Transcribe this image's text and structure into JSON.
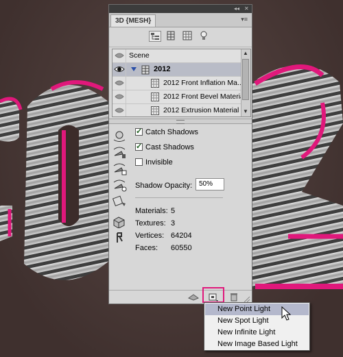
{
  "panel": {
    "tab_title": "3D {MESH}",
    "collapse_glyph": "◂◂",
    "close_glyph": "✕",
    "menu_glyph": "▾≡",
    "toolbar_icons": [
      "scene-filter-icon",
      "mesh-filter-icon",
      "material-filter-icon",
      "light-filter-icon"
    ]
  },
  "scene_list": {
    "items": [
      {
        "label": "Scene",
        "selected": false
      },
      {
        "label": "2012",
        "selected": true
      },
      {
        "label": "2012 Front Inflation Ma...",
        "selected": false
      },
      {
        "label": "2012 Front Bevel Material",
        "selected": false
      },
      {
        "label": "2012 Extrusion Material",
        "selected": false
      }
    ]
  },
  "properties": {
    "catch_shadows": {
      "label": "Catch Shadows",
      "checked": true
    },
    "cast_shadows": {
      "label": "Cast Shadows",
      "checked": true
    },
    "invisible": {
      "label": "Invisible",
      "checked": false
    },
    "shadow_opacity_label": "Shadow Opacity:",
    "shadow_opacity_value": "50%"
  },
  "stats": {
    "materials_label": "Materials:",
    "materials": "5",
    "textures_label": "Textures:",
    "textures": "3",
    "vertices_label": "Vertices:",
    "vertices": "64204",
    "faces_label": "Faces:",
    "faces": "60550"
  },
  "dropdown": {
    "items": [
      "New Point Light",
      "New Spot Light",
      "New Infinite Light",
      "New Image Based Light"
    ],
    "highlighted": "New Point Light"
  },
  "colors": {
    "accent_pink": "#e0187b",
    "panel_bg": "#d7d7d7",
    "selection": "#b9bcc7"
  }
}
